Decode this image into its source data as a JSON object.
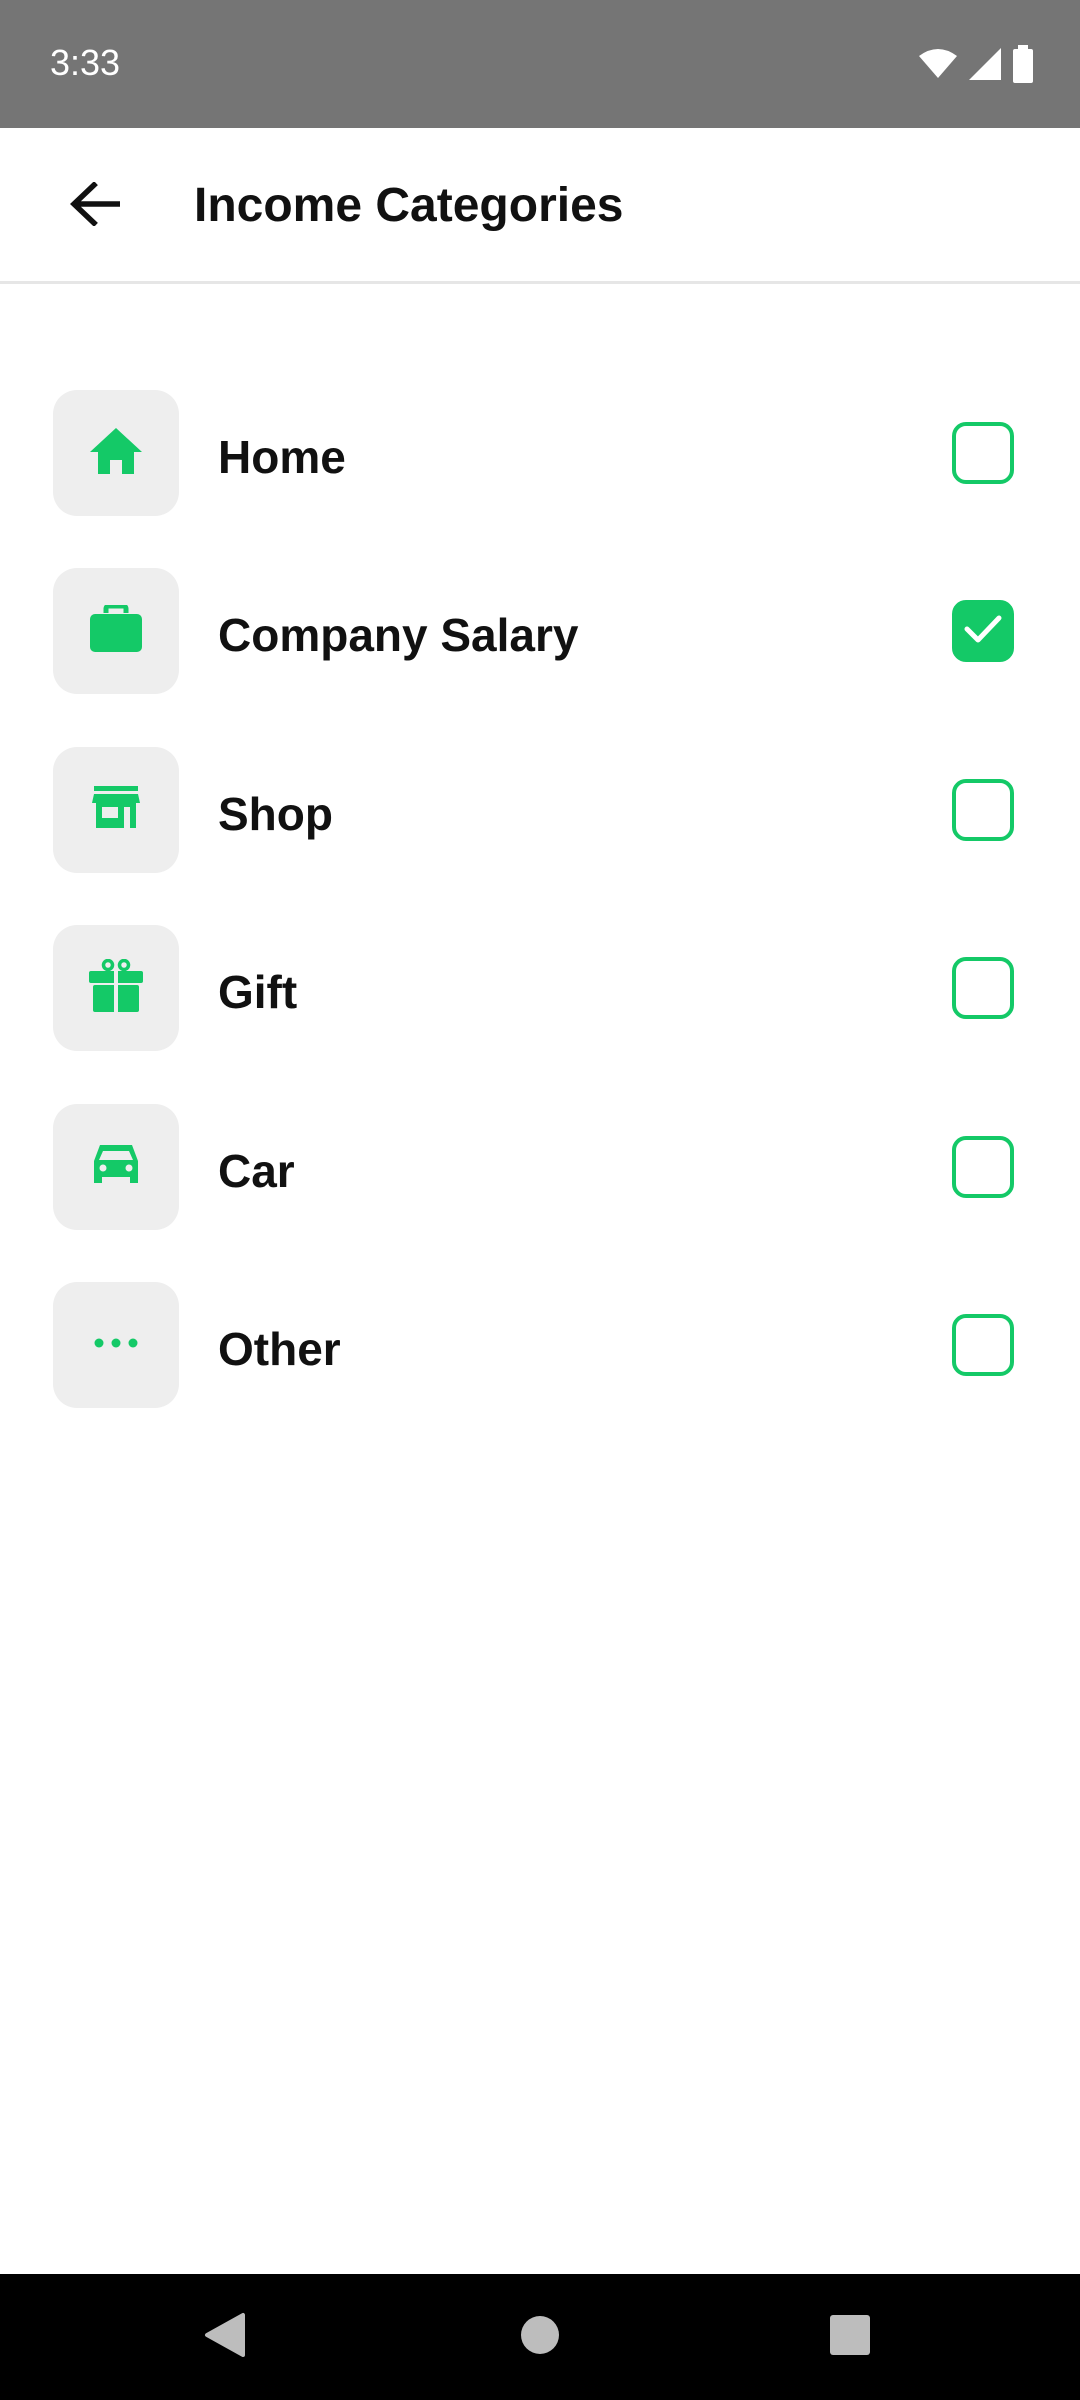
{
  "status_bar": {
    "time": "3:33",
    "icons": [
      "wifi-icon",
      "signal-icon",
      "battery-icon"
    ]
  },
  "app_bar": {
    "back_icon": "arrow-back-icon",
    "title": "Income Categories"
  },
  "colors": {
    "accent": "#14c967",
    "icon_bg": "#eeeeee",
    "status_bar": "#757575",
    "nav_bar": "#000000"
  },
  "categories": [
    {
      "label": "Home",
      "icon": "home-icon",
      "checked": false
    },
    {
      "label": "Company Salary",
      "icon": "briefcase-icon",
      "checked": true
    },
    {
      "label": "Shop",
      "icon": "store-icon",
      "checked": false
    },
    {
      "label": "Gift",
      "icon": "gift-icon",
      "checked": false
    },
    {
      "label": "Car",
      "icon": "car-icon",
      "checked": false
    },
    {
      "label": "Other",
      "icon": "more-horiz-icon",
      "checked": false
    }
  ],
  "nav_bar": {
    "buttons": [
      "nav-back-icon",
      "nav-home-icon",
      "nav-recents-icon"
    ]
  }
}
